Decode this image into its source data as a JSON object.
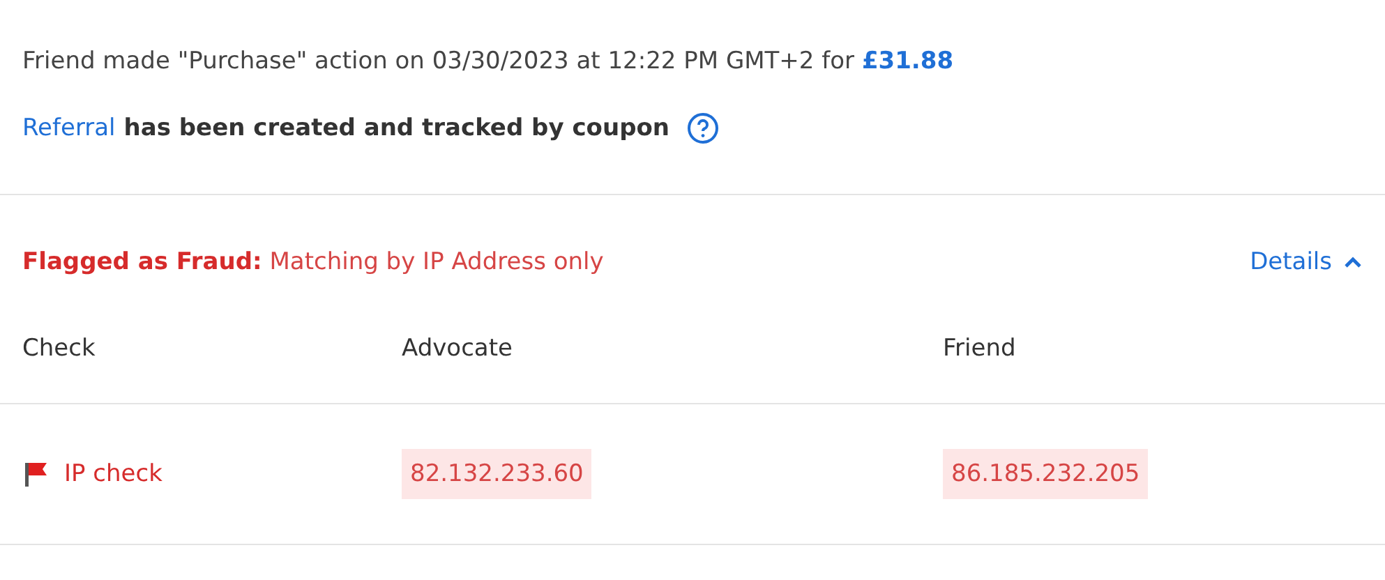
{
  "event": {
    "text": "Friend made \"Purchase\" action on 03/30/2023 at 12:22 PM GMT+2 for",
    "amount": "£31.88"
  },
  "referral": {
    "link": "Referral",
    "text": "has been created and tracked by coupon"
  },
  "fraud": {
    "label": "Flagged as Fraud:",
    "reason": "Matching by IP Address only",
    "details": {
      "label": "Details",
      "expanded": true
    }
  },
  "table": {
    "columns": [
      "Check",
      "Advocate",
      "Friend"
    ],
    "rows": [
      {
        "check": "IP check",
        "flagged": true,
        "advocate": "82.132.233.60",
        "friend": "86.185.232.205",
        "matched": true
      }
    ]
  }
}
